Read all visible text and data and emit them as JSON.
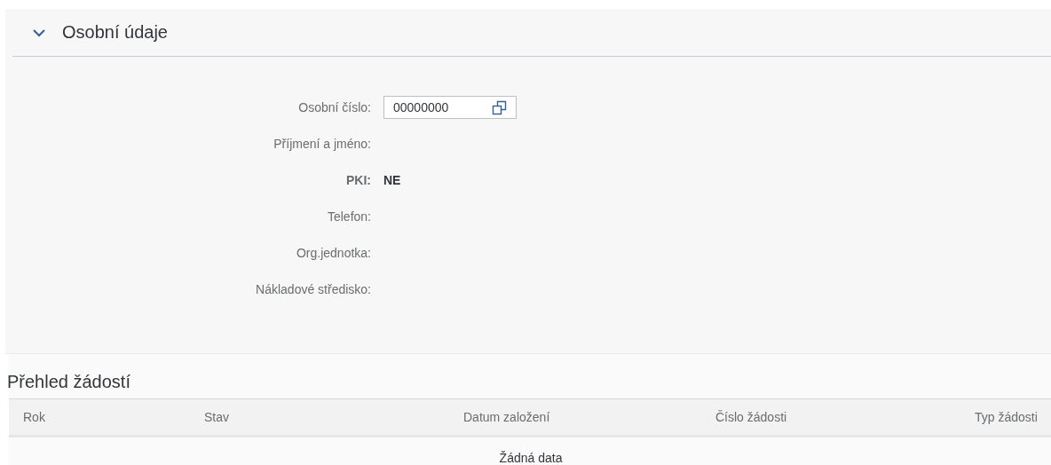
{
  "section": {
    "title": "Osobní údaje",
    "expanded": true,
    "fields": [
      {
        "kind": "input",
        "label": "Osobní číslo:",
        "value": "00000000"
      },
      {
        "kind": "text",
        "label": "Příjmení a jméno:"
      },
      {
        "kind": "strong",
        "label": "PKI:",
        "value": "NE"
      },
      {
        "kind": "text",
        "label": "Telefon:"
      },
      {
        "kind": "text",
        "label": "Org.jednotka:"
      },
      {
        "kind": "text",
        "label": "Nákladové středisko:"
      }
    ]
  },
  "table": {
    "title": "Přehled žádostí",
    "columns": [
      "Rok",
      "Stav",
      "Datum založení",
      "Číslo žádosti",
      "Typ žádosti"
    ],
    "empty_text": "Žádná data"
  }
}
